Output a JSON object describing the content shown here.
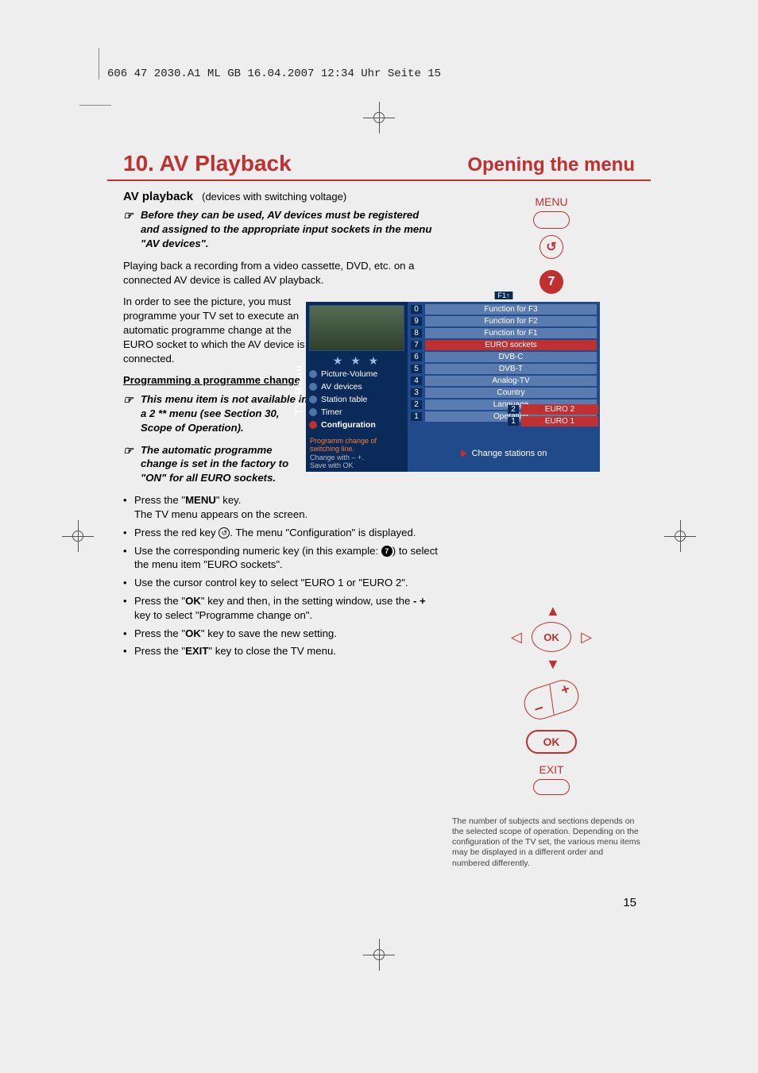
{
  "header_bar": "606 47 2030.A1  ML GB   16.04.2007   12:34 Uhr   Seite 15",
  "chapter_title": "10. AV Playback",
  "section_title": "Opening the menu",
  "subheading": "AV playback",
  "subheading_note": "(devices with switching voltage)",
  "note1": "Before they can be used, AV devices must be registered and assigned to the appropriate input sockets in the menu \"AV devices\".",
  "para1": "Playing back a recording from a video cassette, DVD, etc. on a connected AV device is called AV playback.",
  "para2a": "In order to see the picture, you must programme your TV set to execute an automatic programme change at the EURO socket to which the AV device is connected.",
  "prog_heading": "Programming a programme change",
  "note2": "This menu item is not available in a 2 ** menu (see Section 30, Scope of Operation).",
  "note3": "The automatic programme change is set in the factory to \"ON\" for all EURO sockets.",
  "step1a": "Press the \"",
  "step1b": "MENU",
  "step1c": "\" key.",
  "step1d": "The TV menu appears on the screen.",
  "step2a": "Press the red key ",
  "step2b": ". The menu \"Configuration\" is displayed.",
  "step3a": "Use the corresponding numeric key (in this example: ",
  "step3b": ") to select the menu item \"EURO sockets\".",
  "step4": "Use the cursor control key to select \"EURO 1 or \"EURO 2\".",
  "step5a": "Press the \"",
  "step5b": "OK",
  "step5c": "\" key and then, in the setting window, use the ",
  "step5d": "- +",
  "step5e": " key to select \"Programme change on\".",
  "step6a": "Press the \"",
  "step6b": "OK",
  "step6c": "\" key to save the new setting.",
  "step7a": "Press the \"",
  "step7b": "EXIT",
  "step7c": "\" key to close the TV menu.",
  "rc": {
    "menu": "MENU",
    "num": "7",
    "ok": "OK",
    "ok2": "OK",
    "exit": "EXIT"
  },
  "osd": {
    "side_tab": "TV-Menu",
    "badge": "F1↑",
    "left_menu": [
      "Picture-Volume",
      "AV devices",
      "Station table",
      "Timer",
      "Configuration"
    ],
    "right_items": [
      {
        "n": "0",
        "t": "Function for F3"
      },
      {
        "n": "9",
        "t": "Function for F2"
      },
      {
        "n": "8",
        "t": "Function for F1"
      },
      {
        "n": "7",
        "t": "EURO sockets",
        "sel": true
      },
      {
        "n": "6",
        "t": "DVB-C"
      },
      {
        "n": "5",
        "t": "DVB-T"
      },
      {
        "n": "4",
        "t": "Analog-TV"
      },
      {
        "n": "3",
        "t": "Country"
      },
      {
        "n": "2",
        "t": "Language"
      },
      {
        "n": "1",
        "t": "Operating"
      }
    ],
    "euro": [
      {
        "n": "2",
        "t": "EURO 2"
      },
      {
        "n": "1",
        "t": "EURO 1"
      }
    ],
    "hint1": "Programm change of switching line.",
    "hint2": "Change with – +.",
    "hint3": "Save with OK",
    "footer": "Change stations   on"
  },
  "fine_note": "The number of subjects and sections depends on the selected scope of operation. Depending on the configuration of the TV set, the various menu items may be displayed in a different order and numbered differently.",
  "page_number": "15",
  "inline_num": "7"
}
